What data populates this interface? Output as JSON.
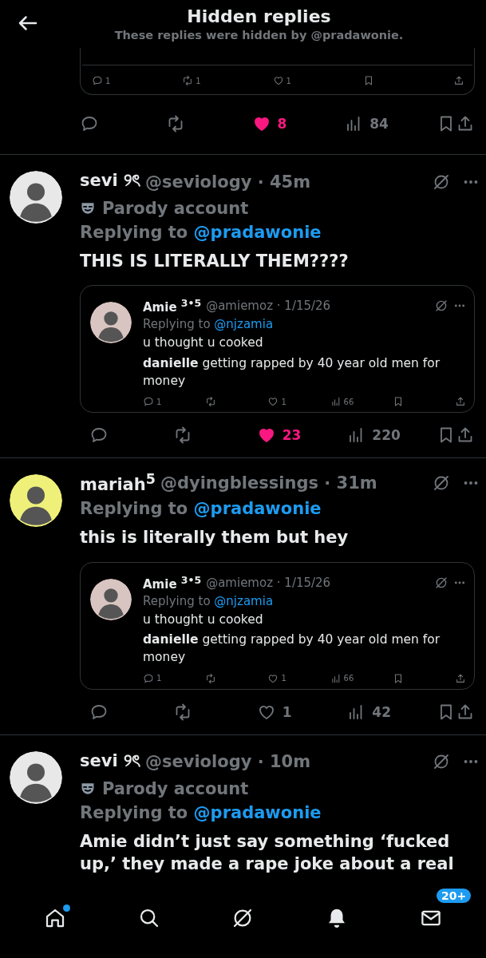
{
  "header": {
    "title": "Hidden replies",
    "subtitle": "These replies were hidden by @pradawonie."
  },
  "top_fragment": {
    "quote_actions": {
      "replies": "1",
      "reposts": "1",
      "likes": "1"
    },
    "actions": {
      "liked": true,
      "likes": "8",
      "views": "84"
    }
  },
  "posts": [
    {
      "avatar": {
        "color": "#e8e8e8"
      },
      "name": "sevi ୨ৎ",
      "meta": "@seviology · 45m",
      "parody": "Parody account",
      "replying": "Replying to",
      "mention": "@pradawonie",
      "body": "THIS IS LITERALLY THEM????",
      "quote": {
        "avatar": {
          "color": "#d8c4c0"
        },
        "name": "Amie $^{3•5}$",
        "meta": "@amiemoz · 1/15/26",
        "replying": "Replying to",
        "mention": "@njzamia",
        "lines": [
          "u thought u cooked",
          "**danielle** getting rapped by 40 year old men for money"
        ],
        "actions": {
          "replies": "1",
          "likes": "1",
          "views": "66"
        }
      },
      "actions": {
        "liked": true,
        "likes": "23",
        "views": "220"
      }
    },
    {
      "avatar": {
        "color": "#eef07a"
      },
      "name": "mariah$^{5}$",
      "meta": "@dyingblessings · 31m",
      "replying": "Replying to",
      "mention": "@pradawonie",
      "body": "this is literally them but hey",
      "quote": {
        "avatar": {
          "color": "#d8c4c0"
        },
        "name": "Amie $^{3•5}$",
        "meta": "@amiemoz · 1/15/26",
        "replying": "Replying to",
        "mention": "@njzamia",
        "lines": [
          "u thought u cooked",
          "**danielle** getting rapped by 40 year old men for money"
        ],
        "actions": {
          "replies": "1",
          "likes": "1",
          "views": "66"
        }
      },
      "actions": {
        "liked": false,
        "likes": "1",
        "views": "42"
      }
    },
    {
      "avatar": {
        "color": "#e8e8e8"
      },
      "name": "sevi ୨ৎ",
      "meta": "@seviology · 10m",
      "parody": "Parody account",
      "replying": "Replying to",
      "mention": "@pradawonie",
      "body": "Amie didn’t just say something ‘fucked up,’ they made a rape joke about a real"
    }
  ],
  "nav": {
    "items": [
      {
        "kind": "home",
        "dot": true
      },
      {
        "kind": "search",
        "dot": false
      },
      {
        "kind": "grok",
        "dot": false
      },
      {
        "kind": "bell",
        "dot": false
      },
      {
        "kind": "mail",
        "dot": false,
        "badge": "20+"
      }
    ]
  }
}
